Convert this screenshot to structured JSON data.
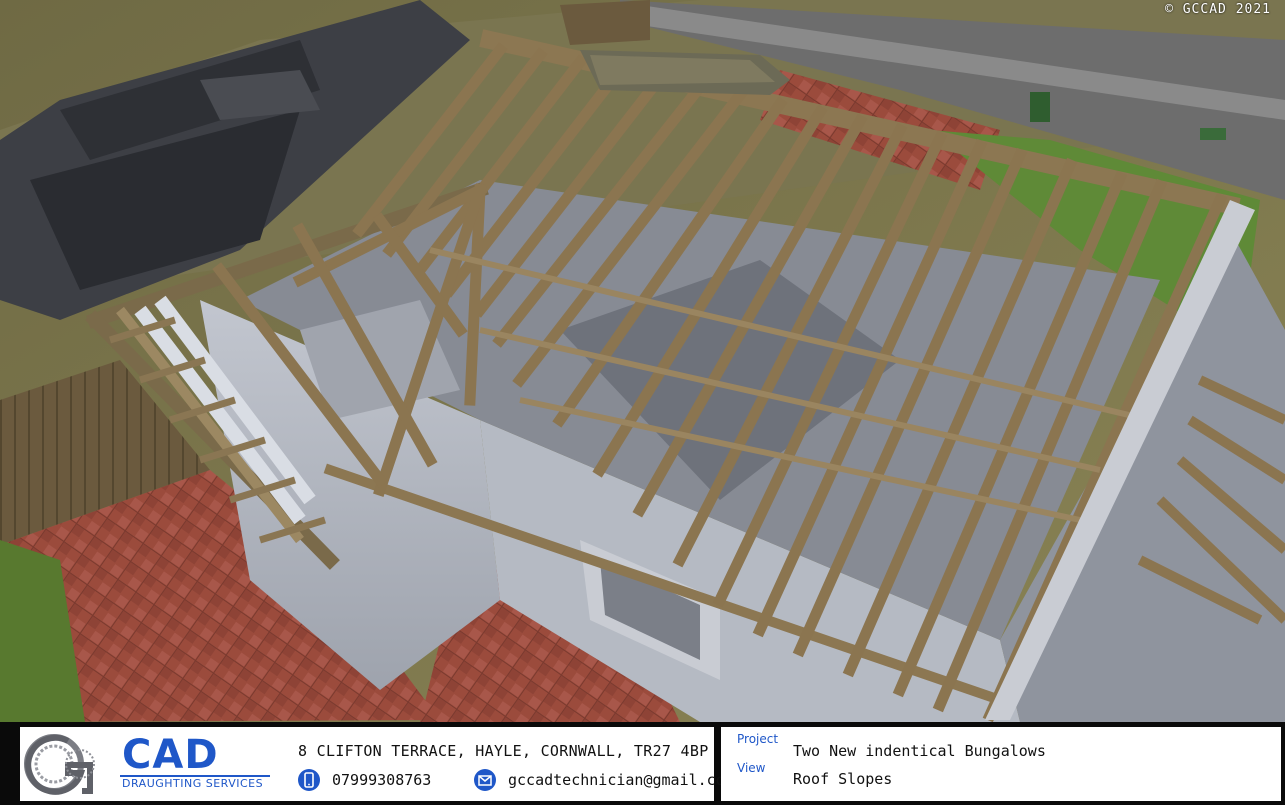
{
  "copyright": "© GCCAD 2021",
  "render": {
    "description_icon": "roof-truss-3d-render"
  },
  "titleblock": {
    "logo": {
      "name": "CAD",
      "subtitle": "DRAUGHTING SERVICES",
      "emblem": "gc-emblem-icon",
      "brand_color": "#1f57c8"
    },
    "address": "8 CLIFTON TERRACE, HAYLE, CORNWALL, TR27 4BP",
    "phone": "07999308763",
    "phone_icon": "phone-icon",
    "email": "gccadtechnician@gmail.com",
    "email_icon": "email-icon",
    "project_label": "Project",
    "project_value": "Two New indentical Bungalows",
    "view_label": "View",
    "view_value": "Roof Slopes"
  }
}
